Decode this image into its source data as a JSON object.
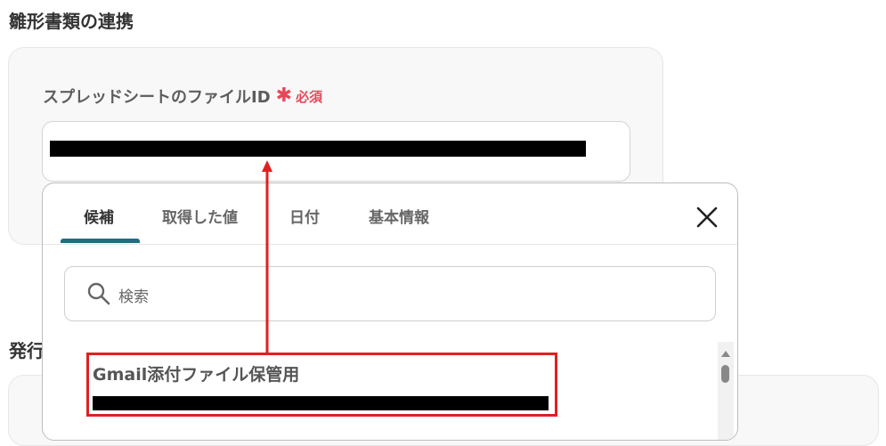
{
  "section": {
    "title": "雛形書類の連携",
    "title2": "発行"
  },
  "field": {
    "label": "スプレッドシートのファイルID",
    "required_star": "✱",
    "required_text": "必須"
  },
  "popup": {
    "tabs": [
      "候補",
      "取得した値",
      "日付",
      "基本情報"
    ],
    "active_tab": "候補",
    "search_placeholder": "検索",
    "options": [
      {
        "title": "Gmail添付ファイル保管用"
      }
    ]
  },
  "colors": {
    "accent": "#1f6f7e",
    "required": "#e8475a",
    "highlight": "#e0201f"
  },
  "icons": {
    "close": "close-icon",
    "search": "search-icon"
  }
}
